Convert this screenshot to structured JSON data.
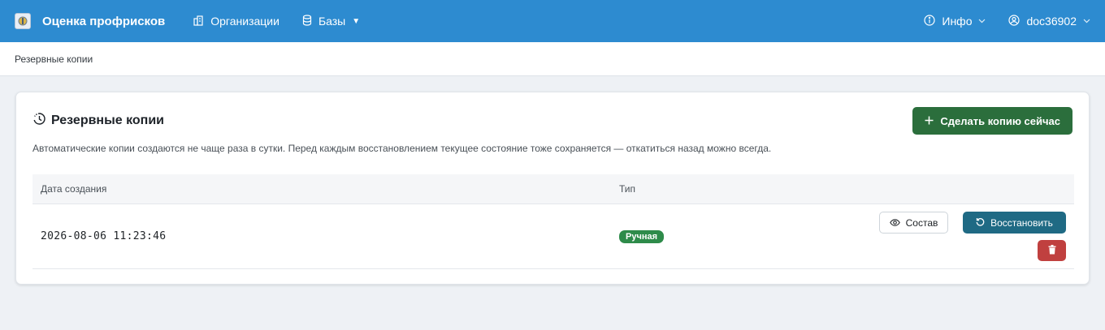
{
  "navbar": {
    "brand_title": "Оценка профрисков",
    "items": [
      {
        "label": "Организации",
        "icon": "building-icon"
      },
      {
        "label": "Базы",
        "icon": "database-icon"
      }
    ],
    "info_label": "Инфо",
    "user_label": "doc36902"
  },
  "breadcrumb": {
    "current": "Резервные копии"
  },
  "card": {
    "title": "Резервные копии",
    "create_button": "Сделать копию сейчас",
    "description": "Автоматические копии создаются не чаще раза в сутки. Перед каждым восстановлением текущее состояние тоже сохраняется — откатиться назад можно всегда."
  },
  "table": {
    "headers": {
      "date": "Дата создания",
      "type": "Тип"
    },
    "rows": [
      {
        "date": "2026-08-06 11:23:46",
        "type": "Ручная",
        "view_label": "Состав",
        "restore_label": "Восстановить"
      }
    ]
  },
  "colors": {
    "navbar": "#2d8bd0",
    "create_button": "#2b6e3c",
    "restore_button": "#1f6a84",
    "delete_button": "#c0403f",
    "badge": "#2e8b4a"
  }
}
